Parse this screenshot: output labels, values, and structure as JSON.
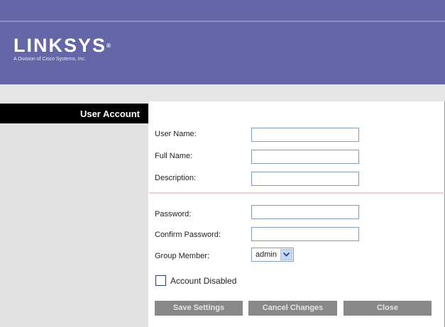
{
  "brand": {
    "name": "LINKSYS",
    "registered": "®",
    "tagline": "A Division of Cisco Systems, Inc."
  },
  "sidebar": {
    "title": "User Account"
  },
  "form": {
    "user_name": {
      "label": "User Name:",
      "value": ""
    },
    "full_name": {
      "label": "Full Name:",
      "value": ""
    },
    "description": {
      "label": "Description:",
      "value": ""
    },
    "password": {
      "label": "Password:",
      "value": ""
    },
    "confirm_password": {
      "label": "Confirm Password:",
      "value": ""
    },
    "group_member": {
      "label": "Group Member:",
      "value": "admin",
      "options": [
        "admin"
      ]
    },
    "account_disabled": {
      "label": "Account Disabled",
      "checked": false
    }
  },
  "buttons": {
    "save": "Save Settings",
    "cancel": "Cancel Changes",
    "close": "Close"
  },
  "colors": {
    "header": "#6566a8",
    "sidebar_title_bg": "#000000",
    "button_bg": "#888888"
  }
}
